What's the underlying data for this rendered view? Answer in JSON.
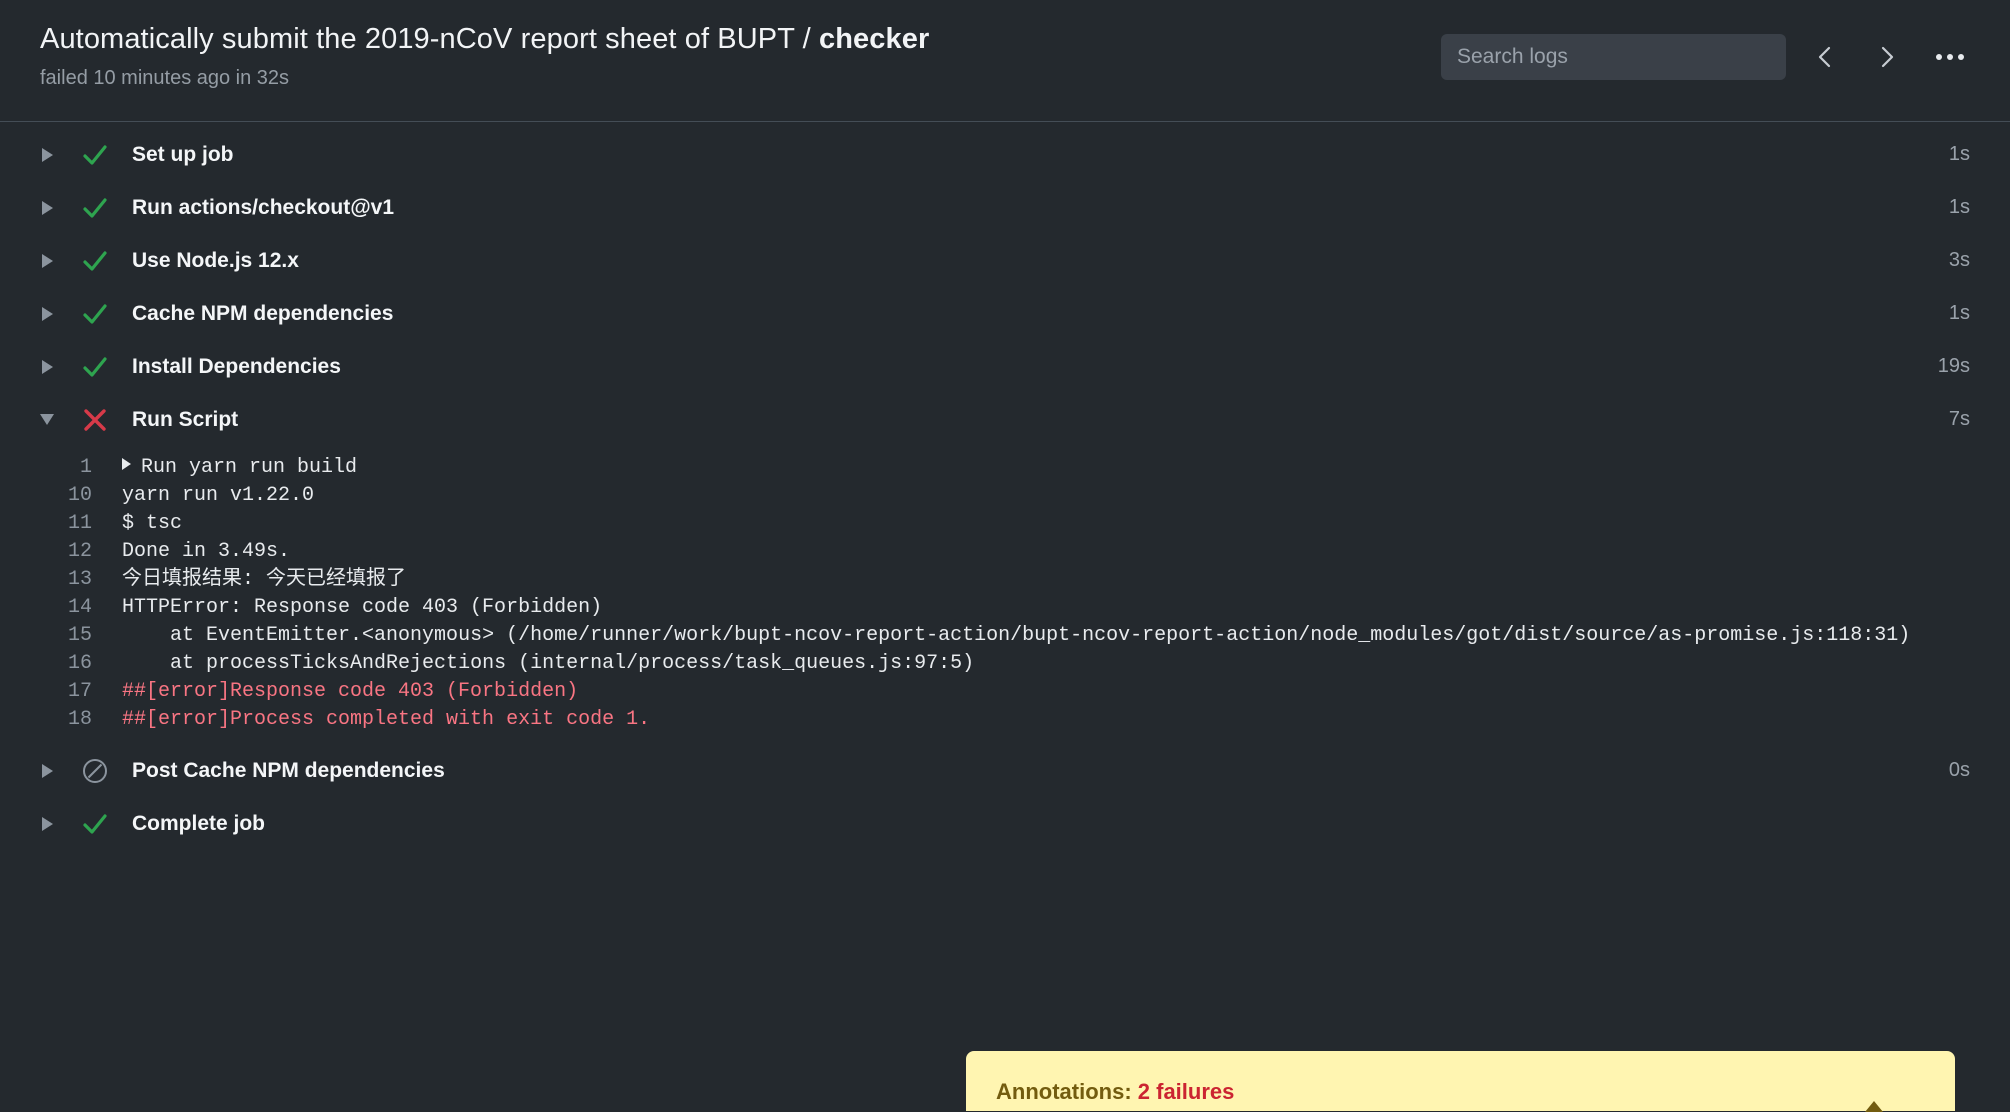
{
  "header": {
    "workflow_name": "Automatically submit the 2019-nCoV report sheet of BUPT",
    "separator": " / ",
    "job_name": "checker",
    "status_line": "failed 10 minutes ago in 32s",
    "search_placeholder": "Search logs",
    "search_value": ""
  },
  "steps": [
    {
      "label": "Set up job",
      "status": "success",
      "duration": "1s",
      "expanded": false
    },
    {
      "label": "Run actions/checkout@v1",
      "status": "success",
      "duration": "1s",
      "expanded": false
    },
    {
      "label": "Use Node.js 12.x",
      "status": "success",
      "duration": "3s",
      "expanded": false
    },
    {
      "label": "Cache NPM dependencies",
      "status": "success",
      "duration": "1s",
      "expanded": false
    },
    {
      "label": "Install Dependencies",
      "status": "success",
      "duration": "19s",
      "expanded": false
    },
    {
      "label": "Run Script",
      "status": "failure",
      "duration": "7s",
      "expanded": true
    },
    {
      "label": "Post Cache NPM dependencies",
      "status": "skipped",
      "duration": "0s",
      "expanded": false
    },
    {
      "label": "Complete job",
      "status": "success",
      "duration": "",
      "expanded": false
    }
  ],
  "log": {
    "lines": [
      {
        "number": "1",
        "text": "Run yarn run build",
        "group": true,
        "error": false
      },
      {
        "number": "10",
        "text": "yarn run v1.22.0",
        "group": false,
        "error": false
      },
      {
        "number": "11",
        "text": "$ tsc",
        "group": false,
        "error": false
      },
      {
        "number": "12",
        "text": "Done in 3.49s.",
        "group": false,
        "error": false
      },
      {
        "number": "13",
        "text": "今日填报结果: 今天已经填报了",
        "group": false,
        "error": false,
        "cjk": true
      },
      {
        "number": "14",
        "text": "HTTPError: Response code 403 (Forbidden)",
        "group": false,
        "error": false
      },
      {
        "number": "15",
        "text": "    at EventEmitter.<anonymous> (/home/runner/work/bupt-ncov-report-action/bupt-ncov-report-action/node_modules/got/dist/source/as-promise.js:118:31)",
        "group": false,
        "error": false
      },
      {
        "number": "16",
        "text": "    at processTicksAndRejections (internal/process/task_queues.js:97:5)",
        "group": false,
        "error": false
      },
      {
        "number": "17",
        "text": "##[error]Response code 403 (Forbidden)",
        "group": false,
        "error": true
      },
      {
        "number": "18",
        "text": "##[error]Process completed with exit code 1.",
        "group": false,
        "error": true
      }
    ]
  },
  "annotations": {
    "label": "Annotations: ",
    "count": "2 failures"
  },
  "icons": {
    "prev": "chevron-left-icon",
    "next": "chevron-right-icon",
    "more": "kebab-menu-icon"
  },
  "colors": {
    "background": "#24292e",
    "success": "#2ea44f",
    "failure": "#d73a49",
    "skipped": "#8b949e",
    "error_text": "#f97583",
    "annotation_bg": "#fff5b1"
  }
}
